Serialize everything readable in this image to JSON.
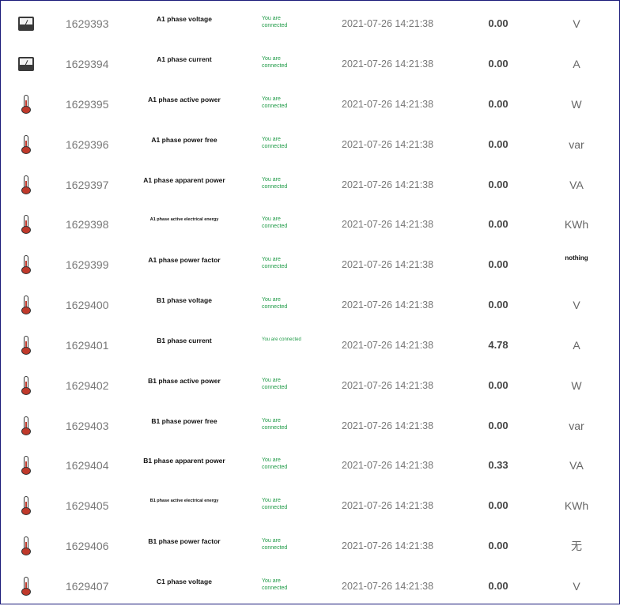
{
  "rows": [
    {
      "icon": "gauge-icon",
      "id": "1629393",
      "name": "A1 phase voltage",
      "status": "You are connected",
      "time": "2021-07-26 14:21:38",
      "value": "0.00",
      "unit": "V"
    },
    {
      "icon": "gauge-icon",
      "id": "1629394",
      "name": "A1 phase current",
      "status": "You are connected",
      "time": "2021-07-26 14:21:38",
      "value": "0.00",
      "unit": "A"
    },
    {
      "icon": "thermometer-icon",
      "id": "1629395",
      "name": "A1 phase active power",
      "status": "You are connected",
      "time": "2021-07-26 14:21:38",
      "value": "0.00",
      "unit": "W"
    },
    {
      "icon": "thermometer-icon",
      "id": "1629396",
      "name": "A1 phase power free",
      "status": "You are connected",
      "time": "2021-07-26 14:21:38",
      "value": "0.00",
      "unit": "var"
    },
    {
      "icon": "thermometer-icon",
      "id": "1629397",
      "name": "A1 phase apparent power",
      "status": "You are connected",
      "time": "2021-07-26 14:21:38",
      "value": "0.00",
      "unit": "VA"
    },
    {
      "icon": "thermometer-icon",
      "id": "1629398",
      "name": "A1 phase active electrical energy",
      "status": "You are connected",
      "time": "2021-07-26 14:21:38",
      "value": "0.00",
      "unit": "KWh"
    },
    {
      "icon": "thermometer-icon",
      "id": "1629399",
      "name": "A1 phase power factor",
      "status": "You are connected",
      "time": "2021-07-26 14:21:38",
      "value": "0.00",
      "unit": "nothing"
    },
    {
      "icon": "thermometer-icon",
      "id": "1629400",
      "name": "B1 phase voltage",
      "status": "You are connected",
      "time": "2021-07-26 14:21:38",
      "value": "0.00",
      "unit": "V"
    },
    {
      "icon": "thermometer-icon",
      "id": "1629401",
      "name": "B1 phase current",
      "status": "You are connected",
      "time": "2021-07-26 14:21:38",
      "value": "4.78",
      "unit": "A"
    },
    {
      "icon": "thermometer-icon",
      "id": "1629402",
      "name": "B1 phase active power",
      "status": "You are connected",
      "time": "2021-07-26 14:21:38",
      "value": "0.00",
      "unit": "W"
    },
    {
      "icon": "thermometer-icon",
      "id": "1629403",
      "name": "B1 phase power free",
      "status": "You are connected",
      "time": "2021-07-26 14:21:38",
      "value": "0.00",
      "unit": "var"
    },
    {
      "icon": "thermometer-icon",
      "id": "1629404",
      "name": "B1 phase apparent power",
      "status": "You are connected",
      "time": "2021-07-26 14:21:38",
      "value": "0.33",
      "unit": "VA"
    },
    {
      "icon": "thermometer-icon",
      "id": "1629405",
      "name": "B1 phase active electrical energy",
      "status": "You are connected",
      "time": "2021-07-26 14:21:38",
      "value": "0.00",
      "unit": "KWh"
    },
    {
      "icon": "thermometer-icon",
      "id": "1629406",
      "name": "B1 phase power factor",
      "status": "You are connected",
      "time": "2021-07-26 14:21:38",
      "value": "0.00",
      "unit": "无"
    },
    {
      "icon": "thermometer-icon",
      "id": "1629407",
      "name": "C1 phase voltage",
      "status": "You are connected",
      "time": "2021-07-26 14:21:38",
      "value": "0.00",
      "unit": "V"
    }
  ],
  "colors": {
    "status": "#1e9a46",
    "frame": "#1a1a7a",
    "thermometer_fill": "#c0392b"
  }
}
